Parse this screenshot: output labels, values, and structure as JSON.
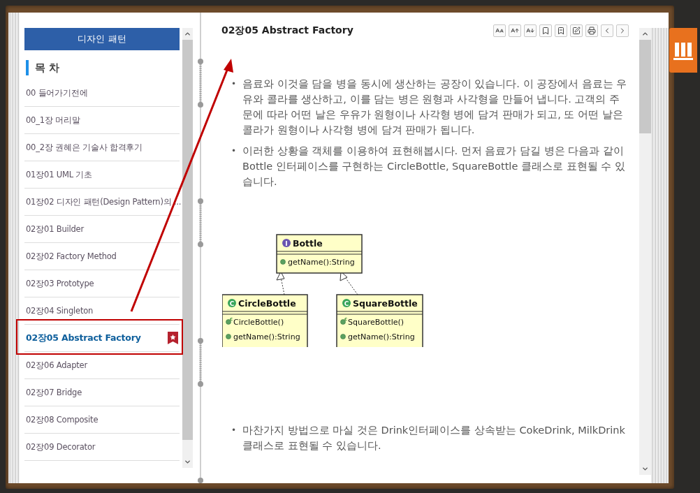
{
  "sidebar": {
    "title": "디자인 패턴",
    "heading": "목 차",
    "items": [
      {
        "label": "00 들어가기전에",
        "selected": false
      },
      {
        "label": "00_1장 머리말",
        "selected": false
      },
      {
        "label": "00_2장 권혜은 기술사 합격후기",
        "selected": false
      },
      {
        "label": "01장01 UML 기초",
        "selected": false
      },
      {
        "label": "01장02 디자인 패턴(Design Pattern)의 ...",
        "selected": false
      },
      {
        "label": "02장01 Builder",
        "selected": false
      },
      {
        "label": "02장02 Factory Method",
        "selected": false
      },
      {
        "label": "02장03 Prototype",
        "selected": false
      },
      {
        "label": "02장04 Singleton",
        "selected": false
      },
      {
        "label": "02장05 Abstract Factory",
        "selected": true
      },
      {
        "label": "02장06 Adapter",
        "selected": false
      },
      {
        "label": "02장07 Bridge",
        "selected": false
      },
      {
        "label": "02장08 Composite",
        "selected": false
      },
      {
        "label": "02장09 Decorator",
        "selected": false
      }
    ]
  },
  "content": {
    "title": "02장05 Abstract Factory",
    "marker": "•",
    "bullets": [
      "음료와 이것을 담을 병을 동시에 생산하는 공장이 있습니다. 이 공장에서 음료는 우유와 콜라를 생산하고, 이를 담는 병은 원형과 사각형을 만들어 냅니다. 고객의 주문에 따라 어떤 날은 우유가 원형이나 사각형 병에 담겨 판매가 되고, 또 어떤 날은 콜라가 원형이나 사각형 병에 담겨 판매가 됩니다.",
      "이러한 상황을 객체를 이용하여 표현해봅시다. 먼저 음료가 담길 병은 다음과 같이 Bottle 인터페이스를 구현하는 CircleBottle, SquareBottle 클래스로 표현될 수 있습니다."
    ],
    "diagram": {
      "classes": [
        {
          "kind": "interface",
          "badge": "I",
          "name": "Bottle",
          "members": [
            {
              "kind": "method",
              "text": "getName():String"
            }
          ]
        },
        {
          "kind": "class",
          "badge": "C",
          "name": "CircleBottle",
          "members": [
            {
              "kind": "constructor",
              "badge": "c",
              "text": "CircleBottle()"
            },
            {
              "kind": "method",
              "text": "getName():String"
            }
          ]
        },
        {
          "kind": "class",
          "badge": "C",
          "name": "SquareBottle",
          "members": [
            {
              "kind": "constructor",
              "badge": "c",
              "text": "SquareBottle()"
            },
            {
              "kind": "method",
              "text": "getName():String"
            }
          ]
        }
      ]
    },
    "bullets_after": [
      "마찬가지 방법으로 마실 것은 Drink인터페이스를 상속받는 CokeDrink, MilkDrink클래스로 표현될 수 있습니다."
    ]
  }
}
